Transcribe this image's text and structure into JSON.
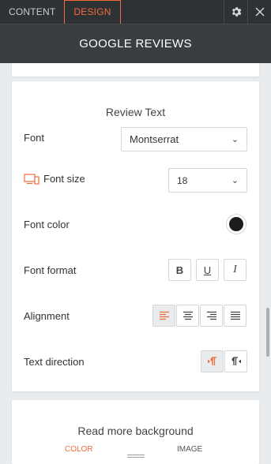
{
  "tabs": {
    "content": "CONTENT",
    "design": "DESIGN"
  },
  "header": {
    "title": "GOOGLE REVIEWS"
  },
  "review_text": {
    "heading": "Review Text",
    "font": {
      "label": "Font",
      "value": "Montserrat"
    },
    "font_size": {
      "label": "Font size",
      "value": "18"
    },
    "font_color": {
      "label": "Font color",
      "color": "#1c1c1c"
    },
    "font_format": {
      "label": "Font format",
      "bold": "B",
      "underline": "U",
      "italic": "I"
    },
    "alignment": {
      "label": "Alignment",
      "selected": "left"
    },
    "text_direction": {
      "label": "Text direction",
      "selected": "ltr"
    }
  },
  "read_more": {
    "heading": "Read more background",
    "color_tab": "COLOR",
    "image_tab": "IMAGE"
  },
  "colors": {
    "accent": "#f26a3b",
    "header_bg": "#3a3e41",
    "tabbar_bg": "#2f3234"
  }
}
